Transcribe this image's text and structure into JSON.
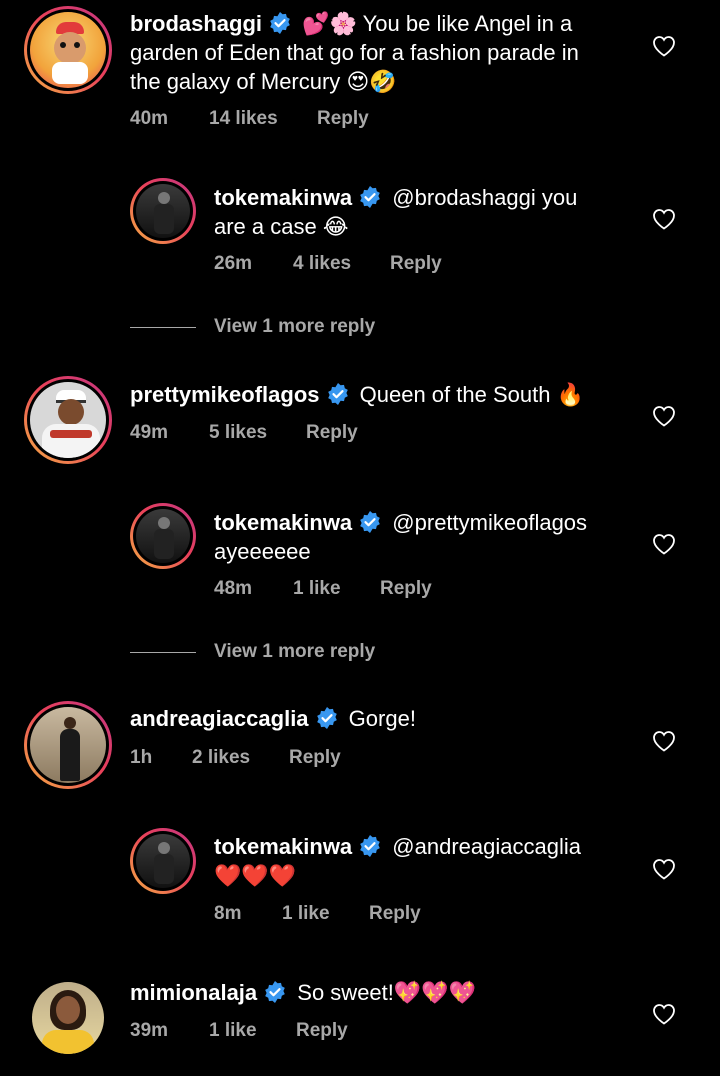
{
  "comments": [
    {
      "username": "brodashaggi",
      "text_line1": "💕🌸 You be like Angel in a",
      "text_line2": "garden of Eden that go for a fashion parade in",
      "text_line3": "the galaxy of Mercury 😍🤣",
      "time": "40m",
      "likes": "14 likes",
      "reply": "Reply"
    },
    {
      "username": "tokemakinwa",
      "text_line1": "@brodashaggi you",
      "text_line2": "are a case 😂",
      "time": "26m",
      "likes": "4 likes",
      "reply": "Reply"
    },
    {
      "view_more": "View 1 more reply"
    },
    {
      "username": "prettymikeoflagos",
      "text_line1": "Queen of the South 🔥",
      "time": "49m",
      "likes": "5 likes",
      "reply": "Reply"
    },
    {
      "username": "tokemakinwa",
      "text_line1": "@prettymikeoflagos",
      "text_line2": "ayeeeeee",
      "time": "48m",
      "likes": "1 like",
      "reply": "Reply"
    },
    {
      "view_more": "View 1 more reply"
    },
    {
      "username": "andreagiaccaglia",
      "text_line1": "Gorge!",
      "time": "1h",
      "likes": "2 likes",
      "reply": "Reply"
    },
    {
      "username": "tokemakinwa",
      "text_line1": "@andreagiaccaglia",
      "text_line2": "❤️❤️❤️",
      "time": "8m",
      "likes": "1 like",
      "reply": "Reply"
    },
    {
      "username": "mimionalaja",
      "text_line1": "So sweet!💖💖💖",
      "time": "39m",
      "likes": "1 like",
      "reply": "Reply"
    }
  ],
  "colors": {
    "background": "#000000",
    "verified": "#3897f0",
    "secondary_text": "#a8a8a8",
    "ring_start": "#f5b043",
    "ring_end": "#c13584"
  }
}
